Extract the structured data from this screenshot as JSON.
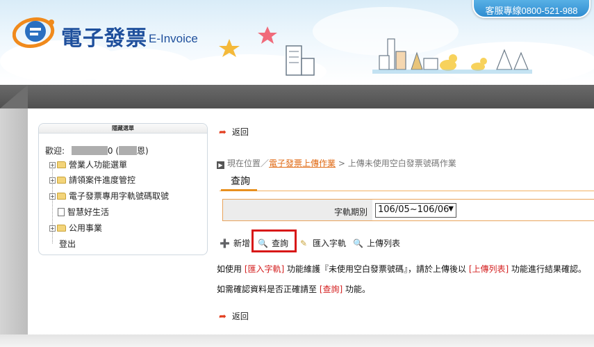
{
  "header": {
    "brand_title": "電子發票",
    "brand_sub": "E-Invoice",
    "hotline": "客服專線0800-521-988"
  },
  "sidebar": {
    "header": "隱藏選單",
    "welcome_prefix": "歡迎:",
    "welcome_mid": "0 (",
    "welcome_suffix": "恩)",
    "items": [
      {
        "label": "營業人功能選單"
      },
      {
        "label": "請領案件進度管控"
      },
      {
        "label": "電子發票專用字軌號碼取號"
      },
      {
        "label": "智慧好生活"
      },
      {
        "label": "公用事業"
      },
      {
        "label": "登出"
      }
    ]
  },
  "main": {
    "back_label": "返回",
    "breadcrumb": {
      "prefix": "現在位置／",
      "link": "電子發票上傳作業",
      "separator": " > ",
      "current": "上傳未使用空白發票號碼作業"
    },
    "section_title": "查詢",
    "form": {
      "period_label": "字軌期別",
      "period_value": "106/05~106/06"
    },
    "toolbar": {
      "add": "新增",
      "query": "查詢",
      "import": "匯入字軌",
      "upload_list": "上傳列表"
    },
    "note1": {
      "a": "如使用 ",
      "b": "[匯入字軌]",
      "c": " 功能維護『未使用空白發票號碼』，請於上傳後以 ",
      "d": "[上傳列表]",
      "e": " 功能進行結果確認。"
    },
    "note2": {
      "a": "如需確認資料是否正確請至 ",
      "b": "[查詢]",
      "c": " 功能。"
    }
  }
}
